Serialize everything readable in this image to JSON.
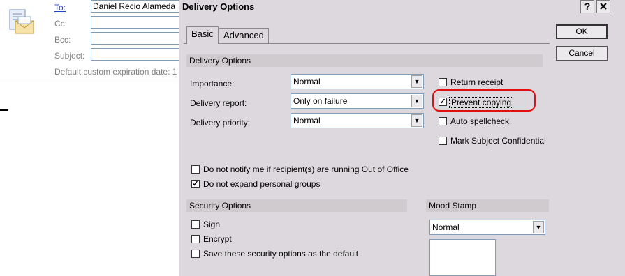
{
  "mail": {
    "to_label": "To:",
    "cc_label": "Cc:",
    "bcc_label": "Bcc:",
    "subject_label": "Subject:",
    "to_value": "Daniel Recio Alameda",
    "expiry_text": "Default custom expiration date: 1"
  },
  "dialog": {
    "title": "Delivery Options",
    "help_button": "?",
    "close_button": "X",
    "tabs": [
      {
        "label": "Basic",
        "active": true
      },
      {
        "label": "Advanced",
        "active": false
      }
    ],
    "ok_label": "OK",
    "cancel_label": "Cancel"
  },
  "delivery": {
    "section_label": "Delivery Options",
    "importance": {
      "label": "Importance:",
      "value": "Normal"
    },
    "report": {
      "label": "Delivery report:",
      "value": "Only on failure"
    },
    "priority": {
      "label": "Delivery priority:",
      "value": "Normal"
    },
    "checkboxes": [
      {
        "label": "Return receipt",
        "checked": false
      },
      {
        "label": "Prevent copying",
        "checked": true
      },
      {
        "label": "Auto spellcheck",
        "checked": false
      },
      {
        "label": "Mark Subject Confidential",
        "checked": false
      }
    ],
    "out_of_office": {
      "label": "Do not notify me if recipient(s) are running Out of Office",
      "checked": false
    },
    "expand_groups": {
      "label": "Do not expand personal groups",
      "checked": true
    }
  },
  "security": {
    "section_label": "Security Options",
    "sign": {
      "label": "Sign",
      "checked": false
    },
    "encrypt": {
      "label": "Encrypt",
      "checked": false
    },
    "save_default": {
      "label": "Save these security options as the default",
      "checked": false
    }
  },
  "mood": {
    "section_label": "Mood Stamp",
    "value": "Normal"
  },
  "colors": {
    "highlight": "#e01010",
    "dialog_bg": "#ddd8dd",
    "link": "#1f3fd0"
  }
}
